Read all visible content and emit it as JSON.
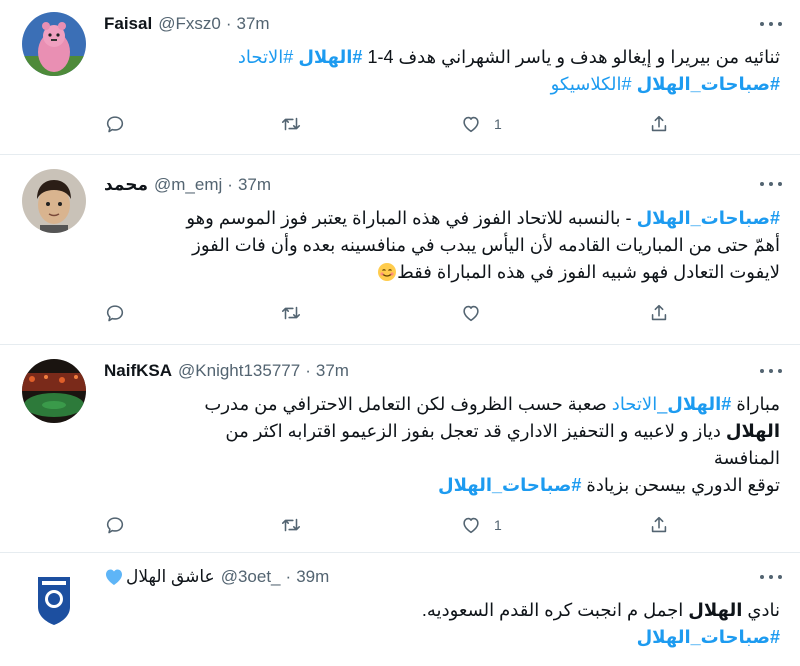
{
  "tweets": [
    {
      "name": "Faisal",
      "handle": "@Fxsz0",
      "sep": "·",
      "time": "37m",
      "line1_a": "ثنائيه من بيريرا و إيغالو هدف و ياسر الشهراني هدف 4-1 ",
      "line1_tag1": "#الهلال",
      "line1_sp": " ",
      "line1_tag2": "#الاتحاد",
      "line2_tag1": "#صباحات_الهلال",
      "line2_sp": " ",
      "line2_tag2": "#الكلاسيكو",
      "likes": "1"
    },
    {
      "name": "محمد",
      "handle": "@m_emj",
      "sep": "·",
      "time": "37m",
      "line1_tag": "#صباحات_الهلال",
      "line1_text": " - بالنسبه للاتحاد الفوز في هذه المباراة يعتبر فوز الموسم  وهو",
      "line2": "أهمّ حتى من المباريات القادمه لأن اليأس يبدب في منافسينه بعده وأن فات الفوز",
      "line3": "لايفوت التعادل فهو شبيه الفوز في هذه المباراة فقط",
      "likes": ""
    },
    {
      "name": "NaifKSA",
      "handle": "@Knight135777",
      "sep": "·",
      "time": "37m",
      "line1_a": "مباراة ",
      "line1_tag1": "#الهلال",
      "line1_sp": " ",
      "line1_tag2": "_الاتحاد",
      "line1_b": " صعبة حسب الظروف لكن التعامل الاحترافي من مدرب",
      "line2_bold": "الهلال",
      "line2_text": " دياز و لاعبيه و التحفيز الاداري قد تعجل بفوز الزعيمو اقترابه اكثر من",
      "line3": "المنافسة",
      "line4_text": "توقع الدوري بيسحن بزيادة  ",
      "line4_tag": "#صباحات_الهلال",
      "likes": "1"
    },
    {
      "name": "عاشق الهلال",
      "handle": "@3oet_",
      "sep": "·",
      "time": "39m",
      "line1_a": "نادي ",
      "line1_bold": "الهلال",
      "line1_b": " اجمل م انجبت كره القدم السعوديه.",
      "line2_tag": "#صباحات_الهلال"
    }
  ],
  "colors": {
    "link": "#1d9bf0",
    "muted": "#536471",
    "heart": "#5eb5f7"
  },
  "icons": [
    "more-icon",
    "reply-icon",
    "retweet-icon",
    "like-icon",
    "share-icon",
    "smiling-face-emoji",
    "blue-heart-emoji"
  ]
}
